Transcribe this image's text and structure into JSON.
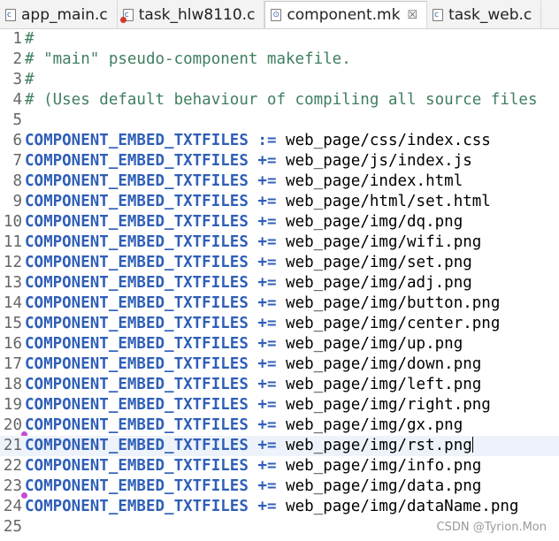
{
  "tabs": [
    {
      "label": "app_main.c",
      "icon": "c-file-icon",
      "active": false
    },
    {
      "label": "task_hlw8110.c",
      "icon": "c-file-error-icon",
      "active": false
    },
    {
      "label": "component.mk",
      "icon": "makefile-icon",
      "active": true,
      "close": "☒"
    },
    {
      "label": "task_web.c",
      "icon": "c-file-icon",
      "active": false
    }
  ],
  "editor": {
    "lines": [
      {
        "n": "1",
        "type": "comment",
        "text": "#"
      },
      {
        "n": "2",
        "type": "comment",
        "text": "# \"main\" pseudo-component makefile."
      },
      {
        "n": "3",
        "type": "comment",
        "text": "#"
      },
      {
        "n": "4",
        "type": "comment",
        "text": "# (Uses default behaviour of compiling all source files"
      },
      {
        "n": "5",
        "type": "blank",
        "text": ""
      },
      {
        "n": "6",
        "type": "assign",
        "var": "COMPONENT_EMBED_TXTFILES",
        "op": ":=",
        "val": "web_page/css/index.css"
      },
      {
        "n": "7",
        "type": "assign",
        "var": "COMPONENT_EMBED_TXTFILES",
        "op": "+=",
        "val": "web_page/js/index.js"
      },
      {
        "n": "8",
        "type": "assign",
        "var": "COMPONENT_EMBED_TXTFILES",
        "op": "+=",
        "val": "web_page/index.html"
      },
      {
        "n": "9",
        "type": "assign",
        "var": "COMPONENT_EMBED_TXTFILES",
        "op": "+=",
        "val": "web_page/html/set.html"
      },
      {
        "n": "10",
        "type": "assign",
        "var": "COMPONENT_EMBED_TXTFILES",
        "op": "+=",
        "val": "web_page/img/dq.png"
      },
      {
        "n": "11",
        "type": "assign",
        "var": "COMPONENT_EMBED_TXTFILES",
        "op": "+=",
        "val": "web_page/img/wifi.png"
      },
      {
        "n": "12",
        "type": "assign",
        "var": "COMPONENT_EMBED_TXTFILES",
        "op": "+=",
        "val": "web_page/img/set.png"
      },
      {
        "n": "13",
        "type": "assign",
        "var": "COMPONENT_EMBED_TXTFILES",
        "op": "+=",
        "val": "web_page/img/adj.png"
      },
      {
        "n": "14",
        "type": "assign",
        "var": "COMPONENT_EMBED_TXTFILES",
        "op": "+=",
        "val": "web_page/img/button.png"
      },
      {
        "n": "15",
        "type": "assign",
        "var": "COMPONENT_EMBED_TXTFILES",
        "op": "+=",
        "val": "web_page/img/center.png"
      },
      {
        "n": "16",
        "type": "assign",
        "var": "COMPONENT_EMBED_TXTFILES",
        "op": "+=",
        "val": "web_page/img/up.png"
      },
      {
        "n": "17",
        "type": "assign",
        "var": "COMPONENT_EMBED_TXTFILES",
        "op": "+=",
        "val": "web_page/img/down.png"
      },
      {
        "n": "18",
        "type": "assign",
        "var": "COMPONENT_EMBED_TXTFILES",
        "op": "+=",
        "val": "web_page/img/left.png"
      },
      {
        "n": "19",
        "type": "assign",
        "var": "COMPONENT_EMBED_TXTFILES",
        "op": "+=",
        "val": "web_page/img/right.png"
      },
      {
        "n": "20",
        "type": "assign",
        "var": "COMPONENT_EMBED_TXTFILES",
        "op": "+=",
        "val": "web_page/img/gx.png",
        "marker": true
      },
      {
        "n": "21",
        "type": "assign",
        "var": "COMPONENT_EMBED_TXTFILES",
        "op": "+=",
        "val": "web_page/img/rst.png",
        "current": true
      },
      {
        "n": "22",
        "type": "assign",
        "var": "COMPONENT_EMBED_TXTFILES",
        "op": "+=",
        "val": "web_page/img/info.png"
      },
      {
        "n": "23",
        "type": "assign",
        "var": "COMPONENT_EMBED_TXTFILES",
        "op": "+=",
        "val": "web_page/img/data.png",
        "marker": true
      },
      {
        "n": "24",
        "type": "assign",
        "var": "COMPONENT_EMBED_TXTFILES",
        "op": "+=",
        "val": "web_page/img/dataName.png"
      },
      {
        "n": "25",
        "type": "blank",
        "text": ""
      }
    ]
  },
  "watermark": "CSDN @Tyrion.Mon",
  "colors": {
    "keyword": "#2f5fb8",
    "comment": "#3f7f5f",
    "current_line": "#eef3fb",
    "marker": "#c84bd8"
  }
}
